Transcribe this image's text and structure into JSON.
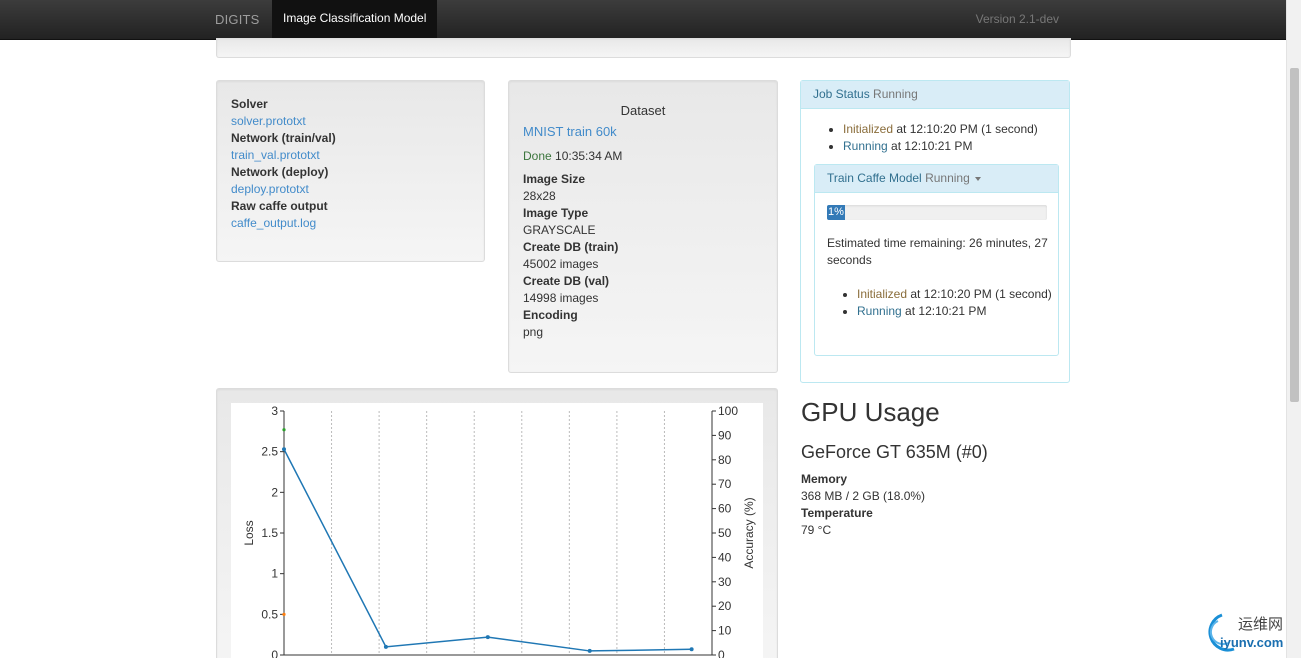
{
  "navbar": {
    "brand": "DIGITS",
    "active_tab": "Image Classification Model",
    "version": "Version 2.1-dev"
  },
  "files": [
    {
      "label": "Solver",
      "file": "solver.prototxt"
    },
    {
      "label": "Network (train/val)",
      "file": "train_val.prototxt"
    },
    {
      "label": "Network (deploy)",
      "file": "deploy.prototxt"
    },
    {
      "label": "Raw caffe output",
      "file": "caffe_output.log"
    }
  ],
  "dataset": {
    "heading": "Dataset",
    "name": "MNIST train 60k",
    "status": "Done",
    "status_time": "10:35:34 AM",
    "fields": [
      {
        "label": "Image Size",
        "value": "28x28"
      },
      {
        "label": "Image Type",
        "value": "GRAYSCALE"
      },
      {
        "label": "Create DB (train)",
        "value": "45002 images"
      },
      {
        "label": "Create DB (val)",
        "value": "14998 images"
      },
      {
        "label": "Encoding",
        "value": "png"
      }
    ]
  },
  "job_status": {
    "title": "Job Status",
    "state": "Running",
    "events": [
      {
        "status": "Initialized",
        "detail": "at 12:10:20 PM (1 second)"
      },
      {
        "status": "Running",
        "detail": "at 12:10:21 PM"
      }
    ]
  },
  "train_task": {
    "title": "Train Caffe Model",
    "state": "Running",
    "progress_percent": 1,
    "progress_label": "1%",
    "eta": "Estimated time remaining: 26 minutes, 27 seconds",
    "events": [
      {
        "status": "Initialized",
        "detail": "at 12:10:20 PM (1 second)"
      },
      {
        "status": "Running",
        "detail": "at 12:10:21 PM"
      }
    ]
  },
  "gpu": {
    "title": "GPU Usage",
    "name": "GeForce GT 635M (#0)",
    "memory_label": "Memory",
    "memory_value": "368 MB / 2 GB (18.0%)",
    "temperature_label": "Temperature",
    "temperature_value": "79 °C"
  },
  "chart_data": {
    "type": "line",
    "ylabel": "Loss",
    "y2label": "Accuracy (%)",
    "ylim": [
      0,
      3
    ],
    "y2lim": [
      0,
      100
    ],
    "yticks": [
      "0",
      "0.5",
      "1",
      "1.5",
      "2",
      "2.5",
      "3"
    ],
    "y2ticks": [
      "0",
      "10",
      "20",
      "30",
      "40",
      "50",
      "60",
      "70",
      "80",
      "90",
      "100"
    ],
    "grid": "vertical",
    "series": [
      {
        "color": "#1f77b4",
        "points": [
          [
            0,
            2.53
          ],
          [
            1,
            0.1
          ],
          [
            2,
            0.22
          ],
          [
            3,
            0.05
          ],
          [
            4,
            0.07
          ]
        ]
      }
    ],
    "markers": [
      {
        "color": "#2ca02c",
        "x": 0,
        "y": 2.77
      },
      {
        "color": "#ff7f0e",
        "x": 0,
        "y": 0.5
      }
    ]
  },
  "watermark": {
    "cn": "运维网",
    "url": "iyunv.com"
  }
}
